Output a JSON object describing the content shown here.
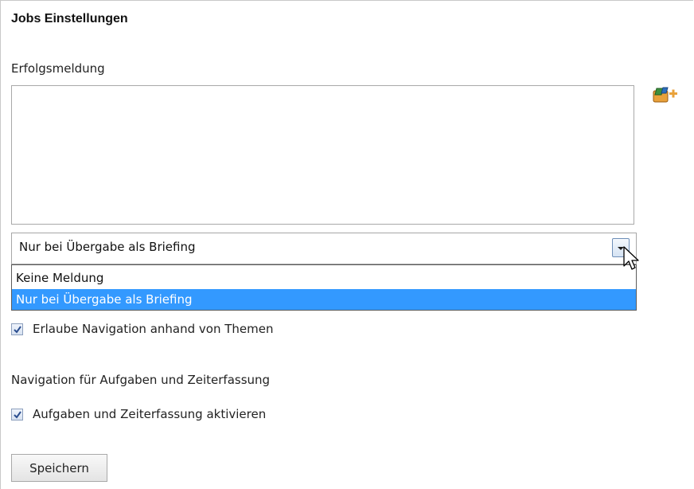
{
  "page": {
    "title": "Jobs Einstellungen"
  },
  "success_message": {
    "label": "Erfolgsmeldung",
    "textarea_value": "",
    "insert_icon": "insert-placeholder-icon",
    "select": {
      "selected": "Nur bei Übergabe als Briefing",
      "options": [
        "Keine Meldung",
        "Nur bei Übergabe als Briefing"
      ],
      "highlighted_index": 1
    }
  },
  "theme_navigation": {
    "checkbox_label": "Erlaube Navigation anhand von Themen",
    "checked": true
  },
  "task_navigation": {
    "heading": "Navigation für Aufgaben und Zeiterfassung",
    "checkbox_label": "Aufgaben und Zeiterfassung aktivieren",
    "checked": true
  },
  "actions": {
    "save_label": "Speichern"
  },
  "colors": {
    "selection_highlight": "#3399ff",
    "checkmark": "#2a4d8f"
  }
}
